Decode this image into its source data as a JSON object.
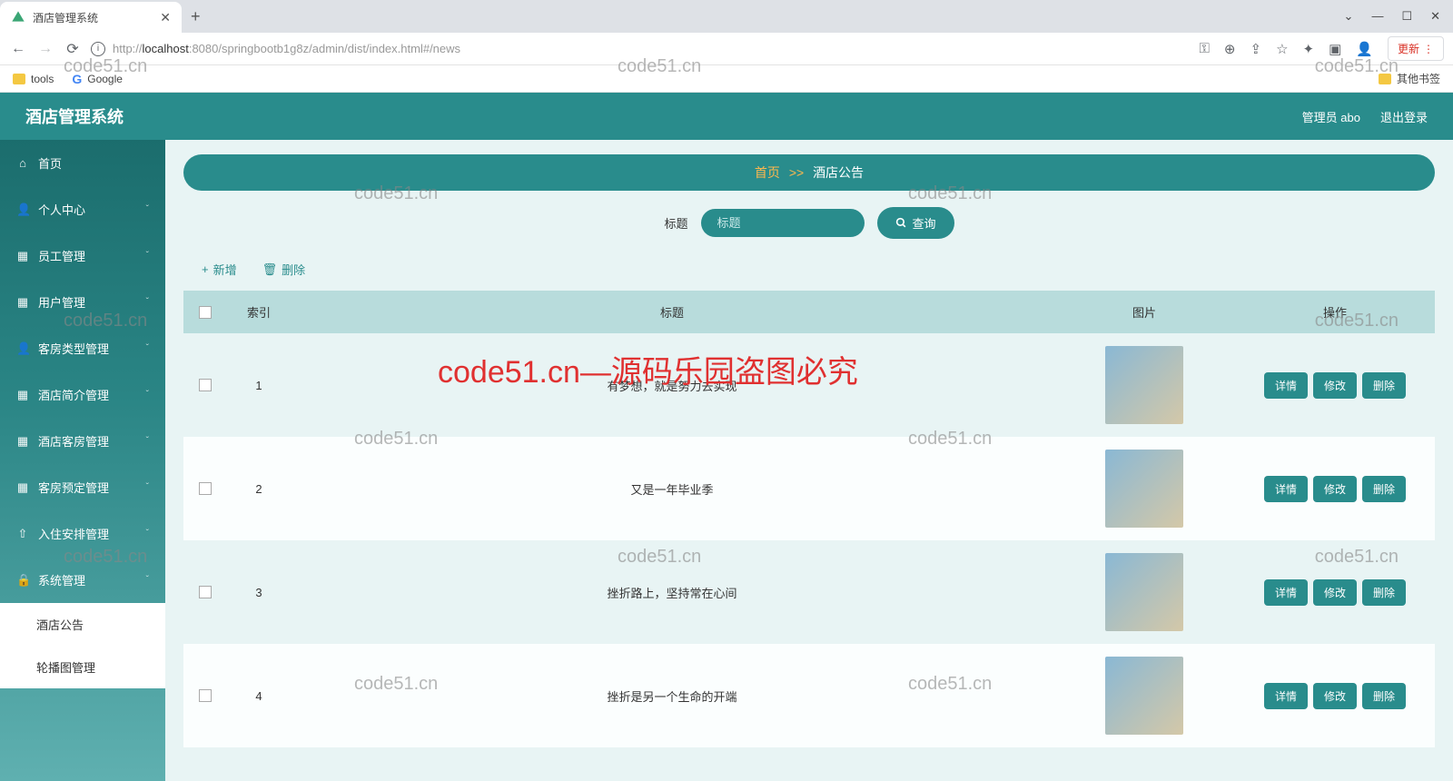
{
  "browser": {
    "tab_title": "酒店管理系统",
    "url_prefix": "http://",
    "url_host": "localhost",
    "url_path": ":8080/springbootb1g8z/admin/dist/index.html#/news",
    "update_label": "更新",
    "bookmarks": {
      "tools": "tools",
      "google": "Google",
      "other": "其他书签"
    }
  },
  "header": {
    "app_name": "酒店管理系统",
    "admin_label": "管理员 abo",
    "logout": "退出登录"
  },
  "sidebar": {
    "items": [
      {
        "label": "首页",
        "icon": "home",
        "expandable": false
      },
      {
        "label": "个人中心",
        "icon": "user",
        "expandable": true
      },
      {
        "label": "员工管理",
        "icon": "grid",
        "expandable": true
      },
      {
        "label": "用户管理",
        "icon": "grid",
        "expandable": true
      },
      {
        "label": "客房类型管理",
        "icon": "user",
        "expandable": true
      },
      {
        "label": "酒店简介管理",
        "icon": "grid",
        "expandable": true
      },
      {
        "label": "酒店客房管理",
        "icon": "grid",
        "expandable": true
      },
      {
        "label": "客房预定管理",
        "icon": "grid",
        "expandable": true
      },
      {
        "label": "入住安排管理",
        "icon": "upload",
        "expandable": true
      },
      {
        "label": "系统管理",
        "icon": "lock",
        "expandable": true
      }
    ],
    "sub": [
      {
        "label": "酒店公告",
        "active": true
      },
      {
        "label": "轮播图管理",
        "active": false
      }
    ]
  },
  "breadcrumb": {
    "home": "首页",
    "sep": ">>",
    "current": "酒店公告"
  },
  "search": {
    "label": "标题",
    "placeholder": "标题",
    "query": "查询"
  },
  "actions": {
    "add": "新增",
    "delete": "删除"
  },
  "table": {
    "headers": {
      "index": "索引",
      "title": "标题",
      "image": "图片",
      "op": "操作"
    },
    "ops": {
      "detail": "详情",
      "edit": "修改",
      "delete": "删除"
    },
    "rows": [
      {
        "index": "1",
        "title": "有梦想，就是努力去实现"
      },
      {
        "index": "2",
        "title": "又是一年毕业季"
      },
      {
        "index": "3",
        "title": "挫折路上，坚持常在心间"
      },
      {
        "index": "4",
        "title": "挫折是另一个生命的开端"
      }
    ]
  },
  "watermark": {
    "small": "code51.cn",
    "large": "code51.cn—源码乐园盗图必究"
  }
}
